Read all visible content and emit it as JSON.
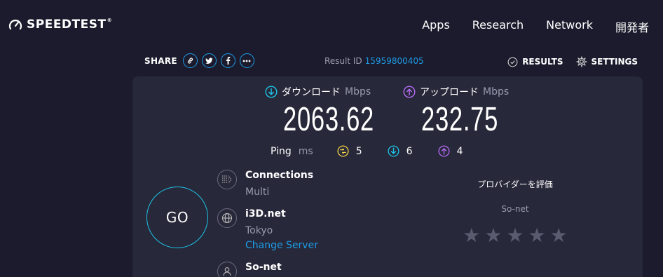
{
  "header": {
    "logo_text": "SPEEDTEST",
    "logo_tm": "®",
    "nav": [
      "Apps",
      "Research",
      "Network",
      "開発者"
    ]
  },
  "share": {
    "label": "SHARE",
    "buttons": [
      "link-icon",
      "twitter-icon",
      "facebook-icon",
      "more-icon"
    ]
  },
  "result": {
    "label": "Result ID",
    "id": "15959800405"
  },
  "top_actions": {
    "results": "RESULTS",
    "settings": "SETTINGS"
  },
  "download": {
    "label": "ダウンロード",
    "unit": "Mbps",
    "value": "2063.62",
    "color": "#1dc4e8"
  },
  "upload": {
    "label": "アップロード",
    "unit": "Mbps",
    "value": "232.75",
    "color": "#b56cf5"
  },
  "ping": {
    "label": "Ping",
    "unit": "ms",
    "idle": "5",
    "download": "6",
    "upload": "4",
    "idle_color": "#f2d24b"
  },
  "go_label": "GO",
  "connections": {
    "title": "Connections",
    "value": "Multi"
  },
  "server": {
    "name": "i3D.net",
    "location": "Tokyo",
    "change": "Change Server"
  },
  "isp": {
    "name": "So-net"
  },
  "rating": {
    "title": "プロバイダーを評価",
    "isp": "So-net",
    "stars_selected": 0,
    "stars_total": 5
  }
}
